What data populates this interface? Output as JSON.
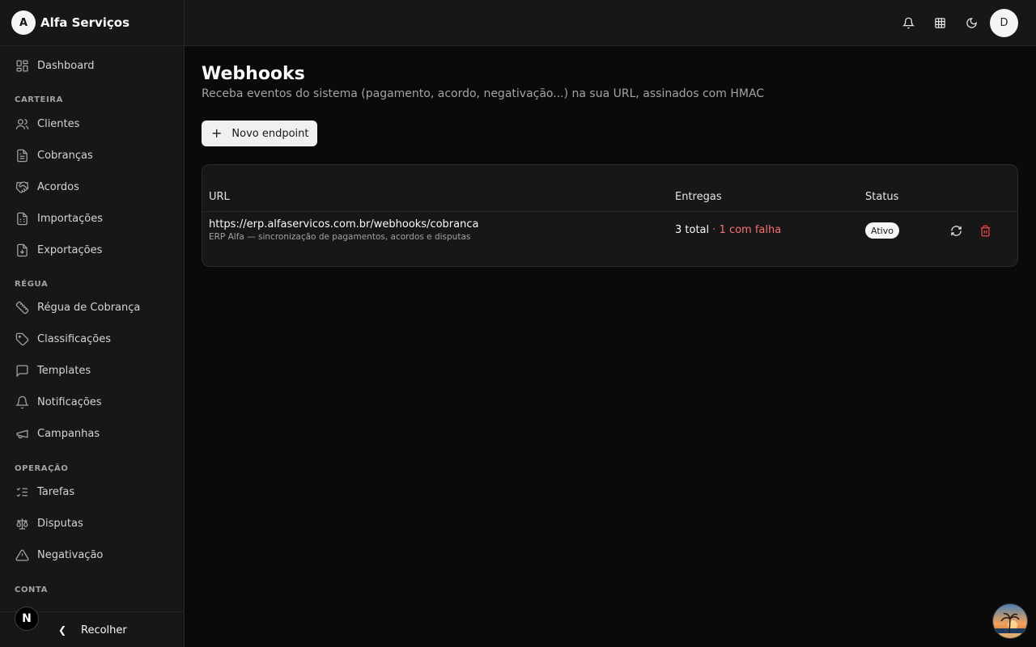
{
  "brand": {
    "initial": "A",
    "name": "Alfa Serviços"
  },
  "sidebar": {
    "dashboard": "Dashboard",
    "sections": {
      "carteira": "CARTEIRA",
      "regua": "RÉGUA",
      "operacao": "OPERAÇÃO",
      "conta": "CONTA"
    },
    "items": {
      "clientes": "Clientes",
      "cobrancas": "Cobranças",
      "acordos": "Acordos",
      "importacoes": "Importações",
      "exportacoes": "Exportações",
      "regua_cobranca": "Régua de Cobrança",
      "classificacoes": "Classificações",
      "templates": "Templates",
      "notificacoes": "Notificações",
      "campanhas": "Campanhas",
      "tarefas": "Tarefas",
      "disputas": "Disputas",
      "negativacao": "Negativação"
    },
    "collapse_label": "Recolher",
    "dev_badge": "N"
  },
  "topbar": {
    "icons": [
      "bell-icon",
      "grid-icon",
      "moon-icon"
    ],
    "user_initial": "D"
  },
  "page": {
    "title": "Webhooks",
    "subtitle": "Receba eventos do sistema (pagamento, acordo, negativação...) na sua URL, assinados com HMAC",
    "new_button": "Novo endpoint",
    "new_button_icon": "+"
  },
  "table": {
    "columns": {
      "url": "URL",
      "entregas": "Entregas",
      "status": "Status"
    },
    "rows": [
      {
        "url": "https://erp.alfaservicos.com.br/webhooks/cobranca",
        "description": "ERP Alfa — sincronização de pagamentos, acordos e disputas",
        "deliveries_total": "3 total",
        "deliveries_separator": " · ",
        "deliveries_failed": "1 com falha",
        "status": "Ativo"
      }
    ]
  },
  "colors": {
    "background": "#0a0a0a",
    "panel": "#171717",
    "danger": "#f87171",
    "badge_bg": "#f5f5f5"
  }
}
